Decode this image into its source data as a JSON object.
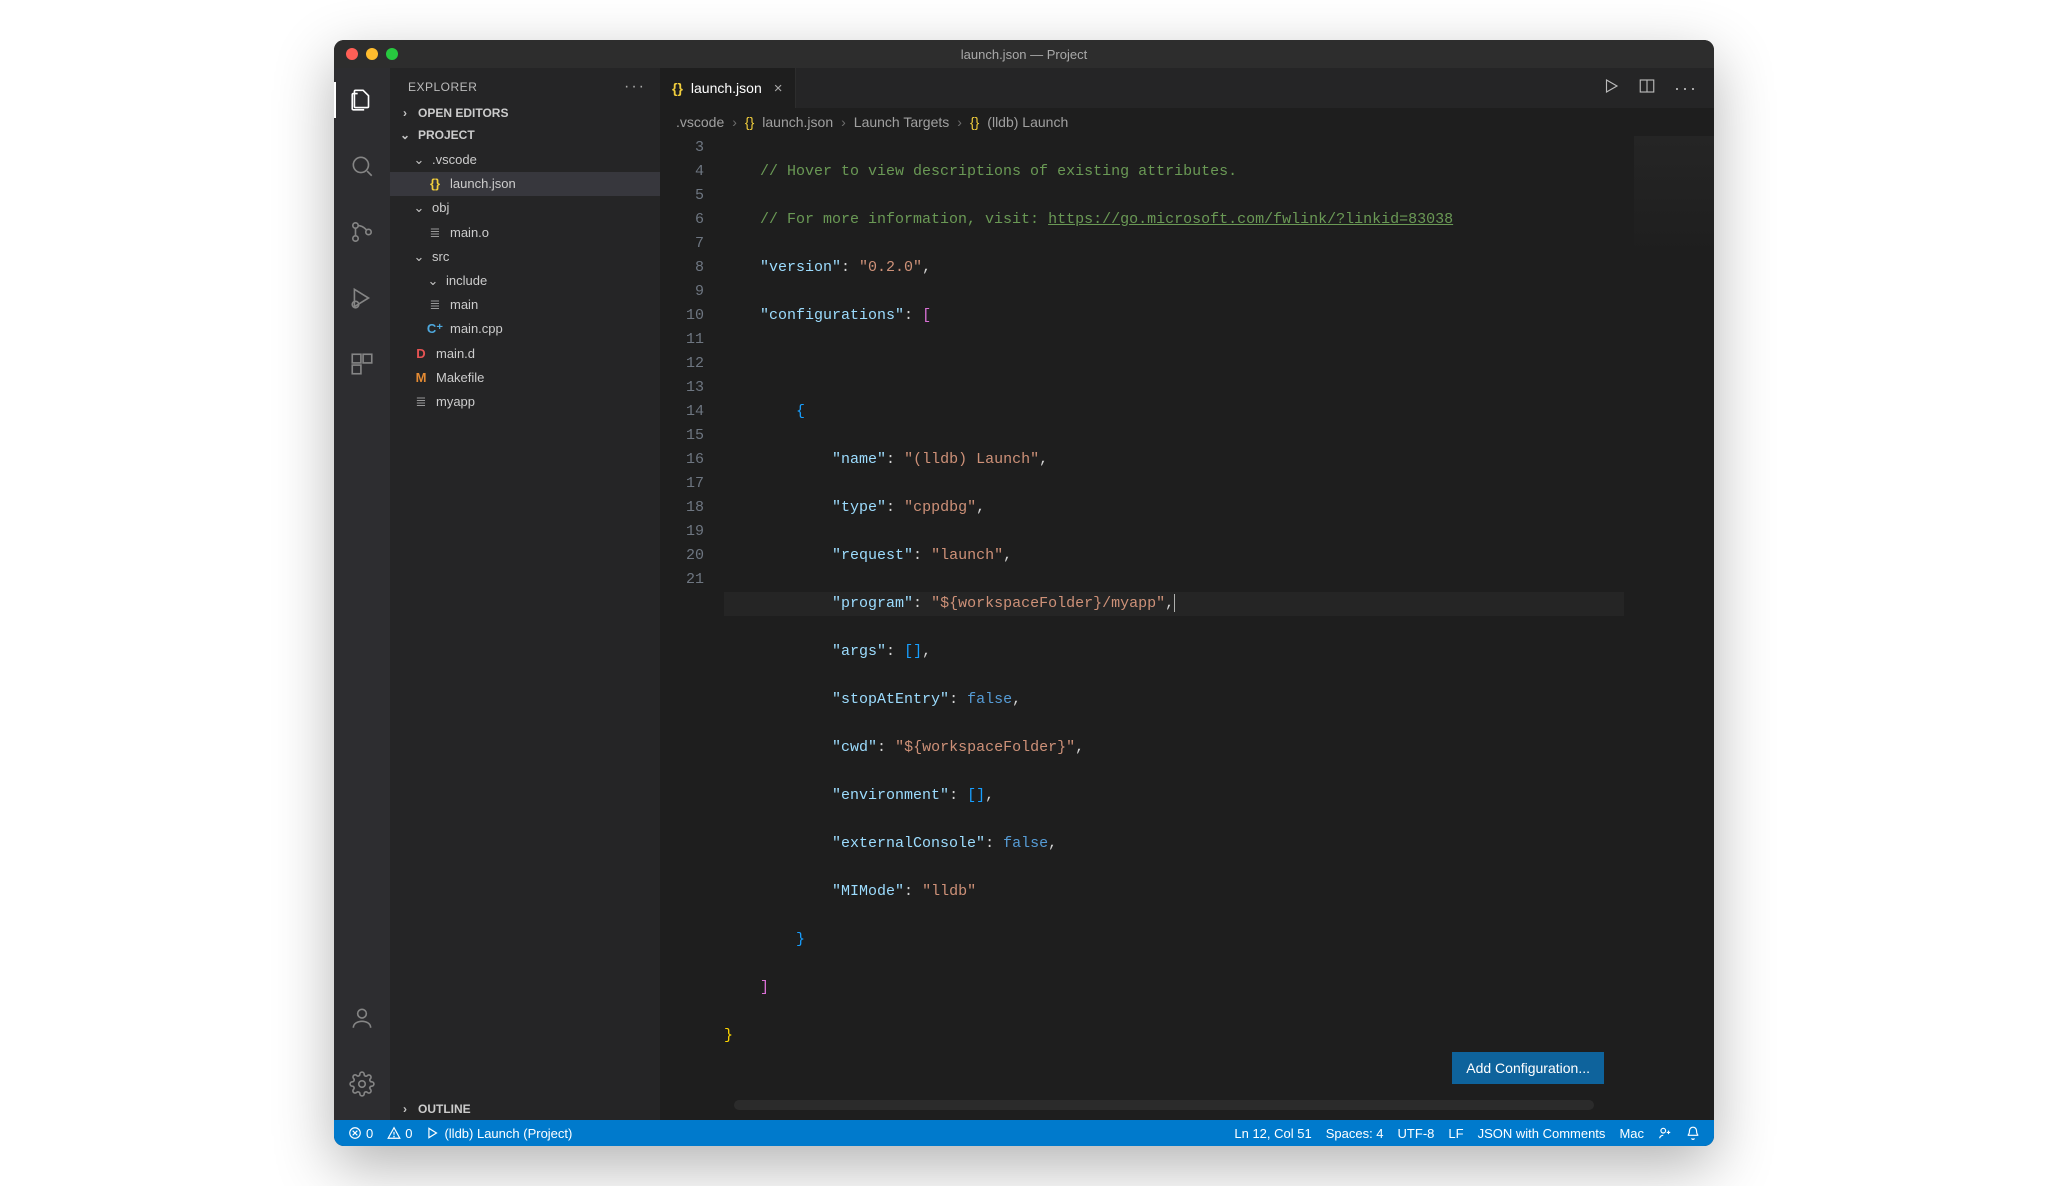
{
  "window": {
    "title": "launch.json — Project"
  },
  "sidebar": {
    "explorer_label": "EXPLORER",
    "open_editors_label": "OPEN EDITORS",
    "project_label": "PROJECT",
    "outline_label": "OUTLINE",
    "tree": {
      "vscode": ".vscode",
      "launchjson": "launch.json",
      "obj": "obj",
      "main_o": "main.o",
      "src": "src",
      "include": "include",
      "main": "main",
      "main_cpp": "main.cpp",
      "main_d": "main.d",
      "makefile": "Makefile",
      "myapp": "myapp"
    }
  },
  "tab": {
    "label": "launch.json"
  },
  "breadcrumbs": {
    "b0": ".vscode",
    "b1": "launch.json",
    "b2": "Launch Targets",
    "b3": "(lldb) Launch"
  },
  "gutter": [
    "3",
    "4",
    "5",
    "6",
    "7",
    "8",
    "9",
    "10",
    "11",
    "12",
    "13",
    "14",
    "15",
    "16",
    "17",
    "18",
    "19",
    "20",
    "21"
  ],
  "code": {
    "comment1": "// Hover to view descriptions of existing attributes.",
    "comment2a": "// For more information, visit: ",
    "comment2b": "https://go.microsoft.com/fwlink/?linkid=83038",
    "k_version": "\"version\"",
    "v_version": "\"0.2.0\"",
    "k_configs": "\"configurations\"",
    "k_name": "\"name\"",
    "v_name": "\"(lldb) Launch\"",
    "k_type": "\"type\"",
    "v_type": "\"cppdbg\"",
    "k_request": "\"request\"",
    "v_request": "\"launch\"",
    "k_program": "\"program\"",
    "v_program": "\"${workspaceFolder}/myapp\"",
    "k_args": "\"args\"",
    "k_stopAtEntry": "\"stopAtEntry\"",
    "v_false": "false",
    "k_cwd": "\"cwd\"",
    "v_cwd": "\"${workspaceFolder}\"",
    "k_environment": "\"environment\"",
    "k_externalConsole": "\"externalConsole\"",
    "k_mimode": "\"MIMode\"",
    "v_mimode": "\"lldb\""
  },
  "add_config_label": "Add Configuration...",
  "status": {
    "errors": "0",
    "warnings": "0",
    "launch_target": "(lldb) Launch (Project)",
    "ln_col": "Ln 12, Col 51",
    "spaces": "Spaces: 4",
    "encoding": "UTF-8",
    "eol": "LF",
    "language": "JSON with Comments",
    "os": "Mac"
  }
}
